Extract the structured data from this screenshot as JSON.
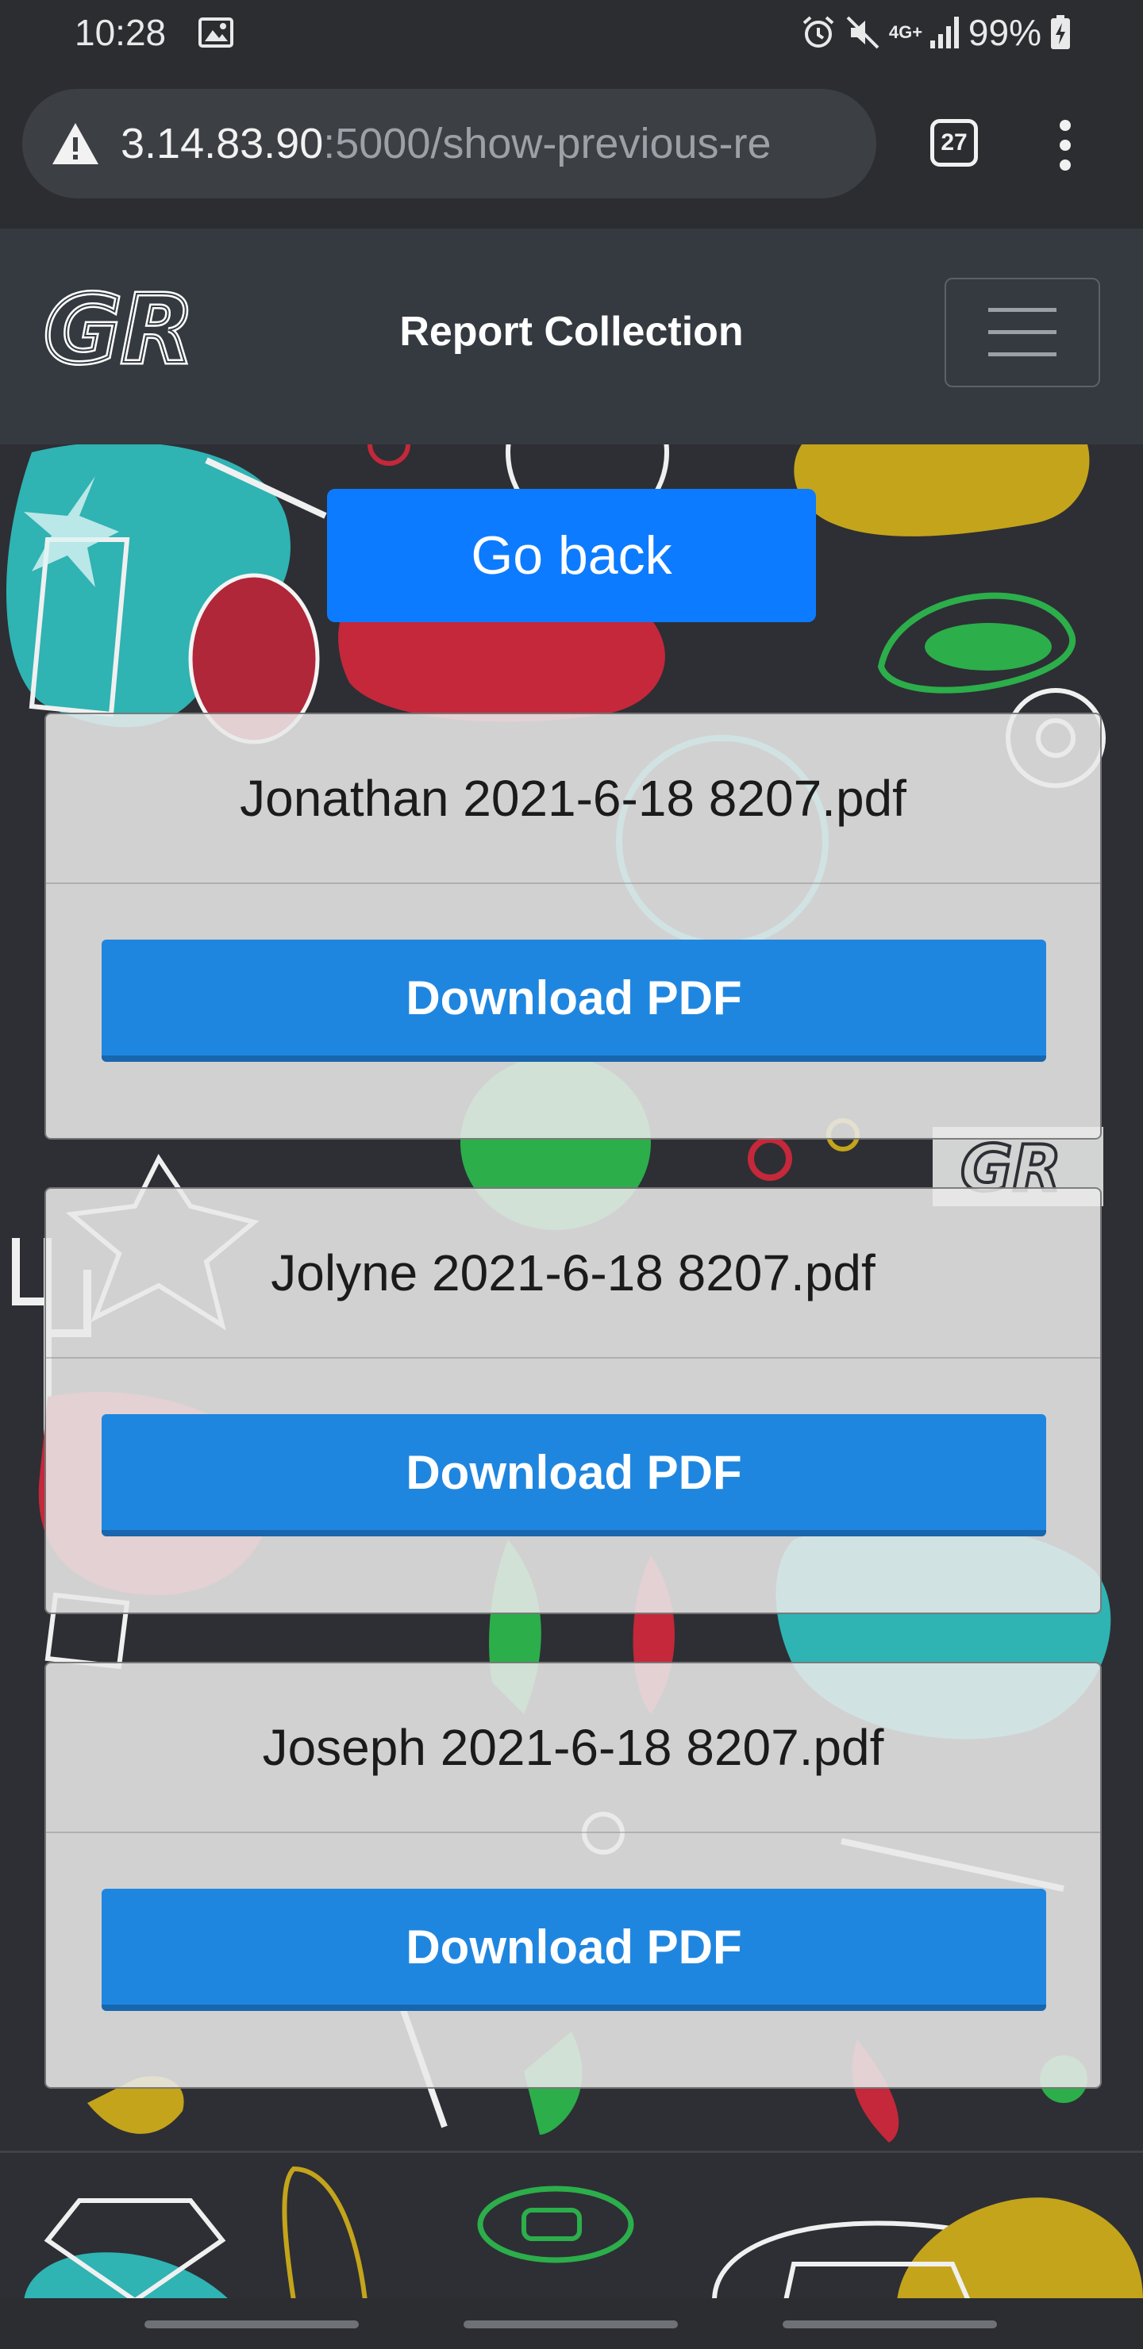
{
  "status_bar": {
    "time": "10:28",
    "network": "4G+",
    "battery": "99%"
  },
  "browser": {
    "url_host": "3.14.83.90",
    "url_rest": ":5000/show-previous-re",
    "tab_count": "27"
  },
  "navbar": {
    "logo_text": "GR",
    "title": "Report Collection"
  },
  "main": {
    "go_back_label": "Go back",
    "reports": [
      {
        "filename": "Jonathan 2021-6-18 8207.pdf",
        "download_label": "Download PDF"
      },
      {
        "filename": "Jolyne 2021-6-18 8207.pdf",
        "download_label": "Download PDF"
      },
      {
        "filename": "Joseph 2021-6-18 8207.pdf",
        "download_label": "Download PDF"
      }
    ]
  },
  "colors": {
    "primary_button": "#0d7bff",
    "download_button": "#1f86e0",
    "navbar_bg": "#343a40",
    "page_bg": "#2d2f34"
  }
}
